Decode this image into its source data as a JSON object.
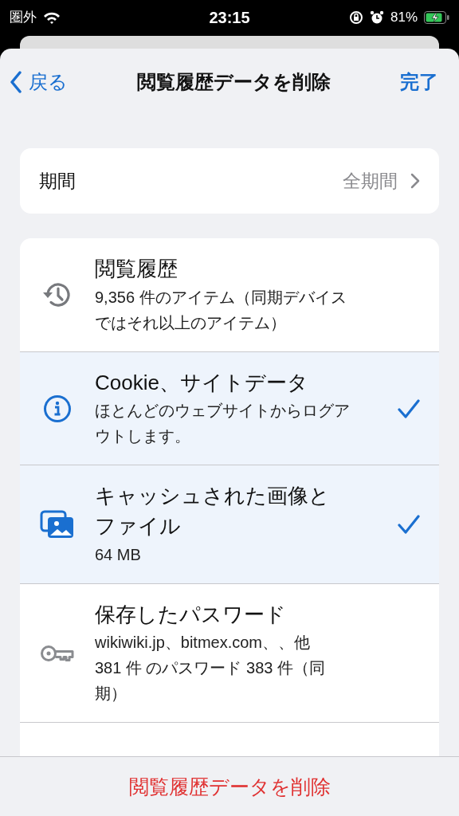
{
  "status_bar": {
    "carrier": "圏外",
    "time": "23:15",
    "battery": "81%"
  },
  "nav": {
    "back": "戻る",
    "title": "閲覧履歴データを削除",
    "done": "完了"
  },
  "period": {
    "label": "期間",
    "value": "全期間"
  },
  "items": [
    {
      "kind": "history",
      "title": "閲覧履歴",
      "detail_lines": [
        "9,356 件のアイテム（同期デバイス",
        "ではそれ以上のアイテム）"
      ],
      "selected": false
    },
    {
      "kind": "cookie",
      "title": "Cookie、サイトデータ",
      "detail_lines": [
        "ほとんどのウェブサイトからログア",
        "ウトします。"
      ],
      "selected": true
    },
    {
      "kind": "cache",
      "title": "キャッシュされた画像とファイル",
      "detail_lines": [
        "64 MB"
      ],
      "selected": true
    },
    {
      "kind": "password",
      "title": "保存したパスワード",
      "detail_lines": [
        "wikiwiki.jp、bitmex.com、、他",
        "381 件 のパスワード 383 件（同",
        "期）"
      ],
      "selected": false
    }
  ],
  "delete_button": "閲覧履歴データを削除"
}
